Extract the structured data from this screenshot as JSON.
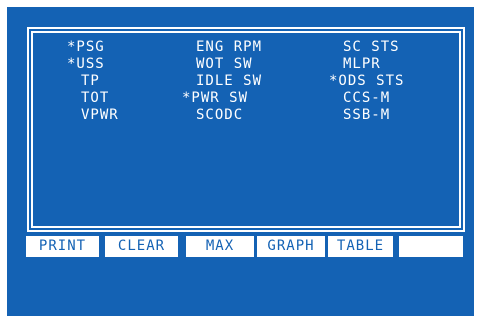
{
  "parameters": {
    "col1": [
      "*PSG",
      "*USS",
      "TP",
      "TOT",
      "VPWR"
    ],
    "col2": [
      "ENG RPM",
      "WOT SW",
      "IDLE SW",
      "*PWR SW",
      "SCODC"
    ],
    "col3": [
      "SC STS",
      "MLPR",
      "*ODS STS",
      "CCS-M",
      "SSB-M"
    ]
  },
  "softkeys": [
    "PRINT",
    "CLEAR",
    "MAX",
    "GRAPH",
    "TABLE",
    ""
  ],
  "colors": {
    "background": "#1462b4",
    "foreground": "#ffffff"
  }
}
